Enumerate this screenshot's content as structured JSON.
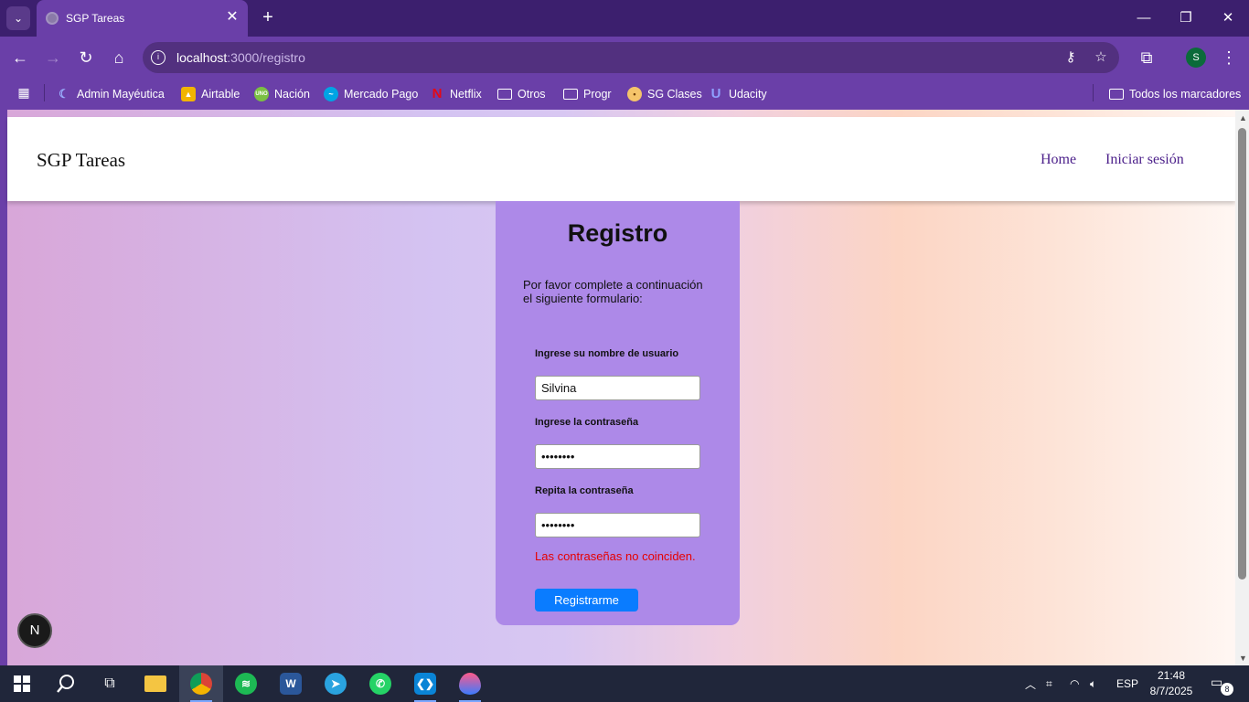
{
  "browser": {
    "tab_title": "SGP Tareas",
    "url_host": "localhost",
    "url_path": ":3000/registro",
    "profile_initial": "S",
    "bookmarks": [
      {
        "label": "Admin Mayéutica",
        "icon": "mayeutica-icon",
        "color": "#4a6bd6"
      },
      {
        "label": "Airtable",
        "icon": "airtable-icon",
        "color": "#f2b400"
      },
      {
        "label": "Nación",
        "icon": "uno-icon",
        "color": "#7bc043"
      },
      {
        "label": "Mercado Pago",
        "icon": "mercadopago-icon",
        "color": "#00a4e4"
      },
      {
        "label": "Netflix",
        "icon": "netflix-icon",
        "color": "#e50914"
      },
      {
        "label": "Otros",
        "icon": "folder-icon"
      },
      {
        "label": "Progr",
        "icon": "folder-icon"
      },
      {
        "label": "SG Clases",
        "icon": "sgclases-icon",
        "color": "#f5c46a"
      },
      {
        "label": "Udacity",
        "icon": "udacity-icon",
        "color": "#2015ff"
      }
    ],
    "all_bookmarks": "Todos los marcadores"
  },
  "site": {
    "brand": "SGP Tareas",
    "nav": {
      "home": "Home",
      "login": "Iniciar sesión"
    }
  },
  "form": {
    "title": "Registro",
    "intro": "Por favor complete a continuación el siguiente formulario:",
    "username_label": "Ingrese su nombre de usuario",
    "username_value": "Silvina",
    "password_label": "Ingrese la contraseña",
    "password_value": "••••••••",
    "repeat_label": "Repita la contraseña",
    "repeat_value": "••••••••",
    "error": "Las contraseñas no coinciden.",
    "submit": "Registrarme"
  },
  "dev_badge": "N",
  "taskbar": {
    "language": "ESP",
    "time": "21:48",
    "date": "8/7/2025",
    "notifications": "8",
    "colors": {
      "chrome": "#db4437",
      "spotify": "#1db954",
      "word": "#2b579a",
      "telegram": "#2aa3df",
      "whatsapp": "#25d366",
      "vscode": "#0a84d6"
    }
  }
}
